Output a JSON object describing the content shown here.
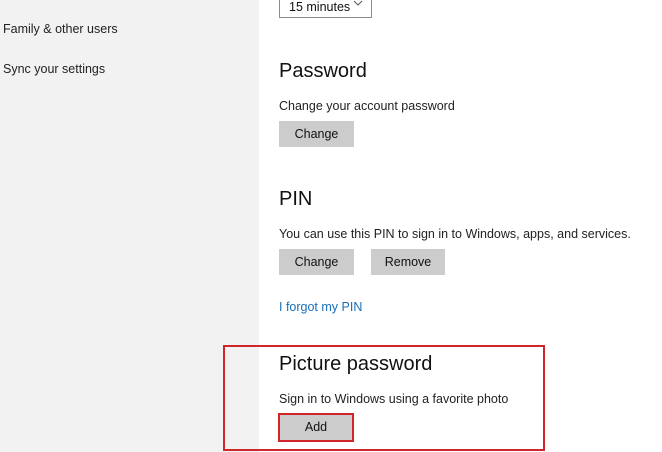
{
  "sidebar": {
    "items": [
      {
        "label": "Family & other users"
      },
      {
        "label": "Sync your settings"
      }
    ]
  },
  "timeout_dropdown": {
    "value": "15 minutes",
    "icon": "chevron-down-icon"
  },
  "password": {
    "title": "Password",
    "description": "Change your account password",
    "change_label": "Change"
  },
  "pin": {
    "title": "PIN",
    "description": "You can use this PIN to sign in to Windows, apps, and services.",
    "change_label": "Change",
    "remove_label": "Remove",
    "forgot_link": "I forgot my PIN"
  },
  "picture_password": {
    "title": "Picture password",
    "description": "Sign in to Windows using a favorite photo",
    "add_label": "Add"
  },
  "colors": {
    "sidebar_bg": "#f2f2f2",
    "button_bg": "#cccccc",
    "link": "#1a6fb8",
    "highlight": "#d0252b"
  }
}
